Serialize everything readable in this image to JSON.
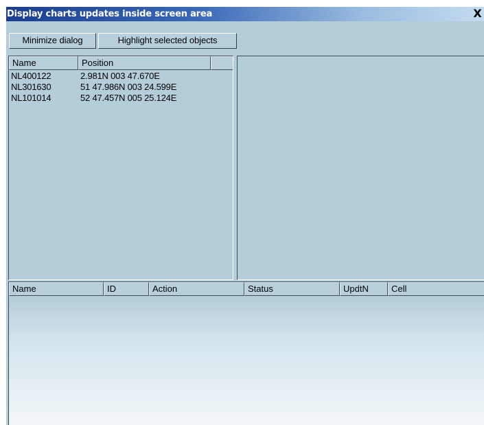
{
  "window": {
    "title": "Display charts updates inside screen area",
    "close_glyph": "X"
  },
  "toolbar": {
    "minimize_label": "Minimize dialog",
    "highlight_label": "Highlight selected objects"
  },
  "upper_list": {
    "columns": [
      "Name",
      "Position",
      ""
    ],
    "rows": [
      {
        "name": "NL400122",
        "position": "2.981N 003 47.670E"
      },
      {
        "name": "NL301630",
        "position": "51 47.986N 003 24.599E"
      },
      {
        "name": "NL101014",
        "position": "52 47.457N 005 25.124E"
      }
    ]
  },
  "lower_list": {
    "columns": [
      "Name",
      "ID",
      "Action",
      "Status",
      "UpdtN",
      "Cell"
    ]
  },
  "colors": {
    "panel_bg": "#b3cdd9",
    "title_gradient_start": "#1a3d8e",
    "title_gradient_end": "#c4dbef",
    "title_text": "#ffffff"
  }
}
